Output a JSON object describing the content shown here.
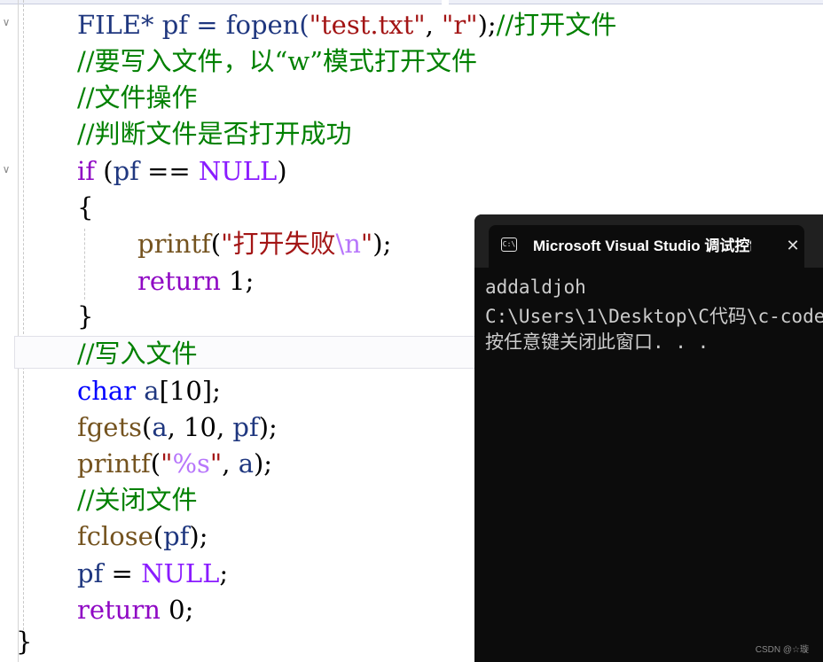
{
  "editor": {
    "fold_glyph": "∨",
    "lines": {
      "l1_code": "FILE* pf = fopen(",
      "l1_str1": "\"test.txt\"",
      "l1_sep": ", ",
      "l1_str2": "\"r\"",
      "l1_end": ");",
      "l1_comment": "//打开文件",
      "l2_comment": "//要写入文件，以“w”模式打开文件",
      "l3_comment": "//文件操作",
      "l4_comment": "//判断文件是否打开成功",
      "l5_if": "if",
      "l5_open": " (",
      "l5_pf": "pf",
      "l5_eq": " == ",
      "l5_null": "NULL",
      "l5_close": ")",
      "l6_brace": "{",
      "l7_printf": "printf",
      "l7_open": "(",
      "l7_str": "\"打开失败",
      "l7_esc": "\\n",
      "l7_strq": "\"",
      "l7_end": ");",
      "l8_return": "return",
      "l8_val": " 1;",
      "l9_brace": "}",
      "l10_comment": "//写入文件",
      "l11_char": "char",
      "l11_a": " a",
      "l11_rest": "[10];",
      "l12_fgets": "fgets",
      "l12_open": "(",
      "l12_a": "a",
      "l12_mid": ", 10, ",
      "l12_pf": "pf",
      "l12_end": ");",
      "l13_printf": "printf",
      "l13_open": "(",
      "l13_str1": "\"",
      "l13_fmt": "%s",
      "l13_str2": "\"",
      "l13_sep": ", ",
      "l13_a": "a",
      "l13_end": ");",
      "l14_comment": "//关闭文件",
      "l15_fclose": "fclose",
      "l15_open": "(",
      "l15_pf": "pf",
      "l15_end": ");",
      "l16_pf": "pf",
      "l16_eq": " = ",
      "l16_null": "NULL",
      "l16_end": ";",
      "l17_return": "return",
      "l17_val": " 0;",
      "l18_brace": "}"
    }
  },
  "console": {
    "title": "Microsoft Visual Studio 调试控制台",
    "icon_text": "C:\\",
    "close_glyph": "✕",
    "output": [
      "addaldjoh",
      "C:\\Users\\1\\Desktop\\C代码\\c-code",
      "按任意键关闭此窗口. . ."
    ]
  },
  "watermark": "CSDN @☆璇"
}
